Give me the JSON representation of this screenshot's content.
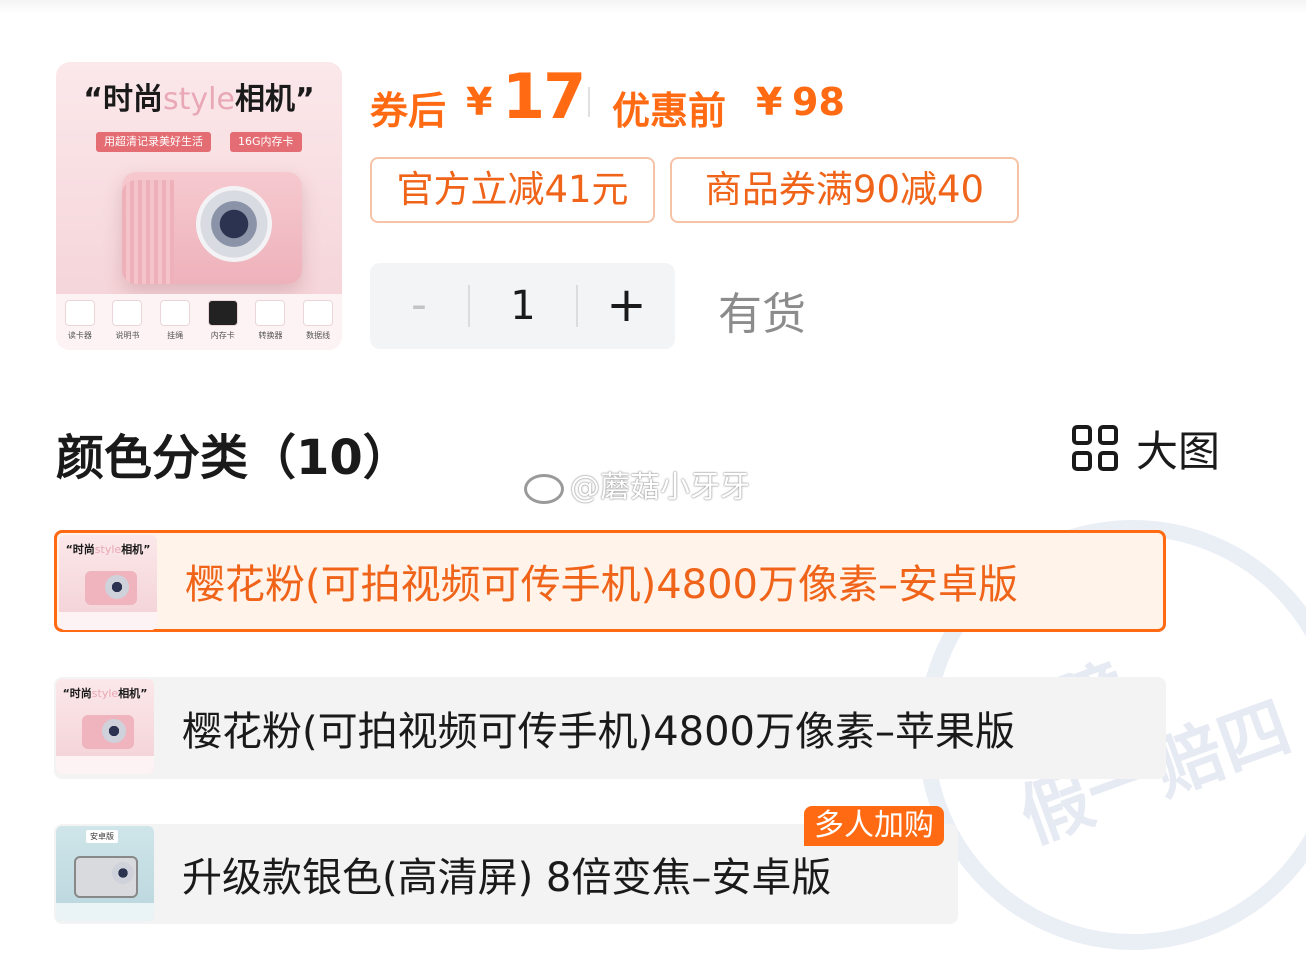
{
  "product": {
    "thumb_headline_prefix": "时尚",
    "thumb_headline_style": "style",
    "thumb_headline_suffix": "相机",
    "thumb_tags": [
      "用超清记录美好生活",
      "16G内存卡"
    ],
    "thumb_accessories": [
      "读卡器",
      "说明书",
      "挂绳",
      "内存卡",
      "转换器",
      "数据线"
    ]
  },
  "price": {
    "after_label": "券后",
    "currency": "¥",
    "after_value": "17",
    "before_label": "优惠前",
    "before_value": "98"
  },
  "coupons": [
    "官方立减41元",
    "商品券满90减40"
  ],
  "quantity": {
    "minus": "-",
    "value": "1",
    "plus": "+",
    "stock_status": "有货"
  },
  "section": {
    "title": "颜色分类（10）",
    "view_toggle": "大图"
  },
  "watermark": "@蘑菇小牙牙",
  "stamp_text": [
    "保障",
    "假一赔四"
  ],
  "options": [
    {
      "label": "樱花粉(可拍视频可传手机)4800万像素–安卓版",
      "selected": true
    },
    {
      "label": "樱花粉(可拍视频可传手机)4800万像素–苹果版",
      "selected": false
    },
    {
      "label": "升级款银色(高清屏) 8倍变焦–安卓版",
      "selected": false,
      "badge": "多人加购",
      "thumb_badge": "安卓版"
    }
  ],
  "colors": {
    "accent": "#ff6a12",
    "coupon_border": "#f7c3a7",
    "stock_text": "#8c8c8c"
  }
}
